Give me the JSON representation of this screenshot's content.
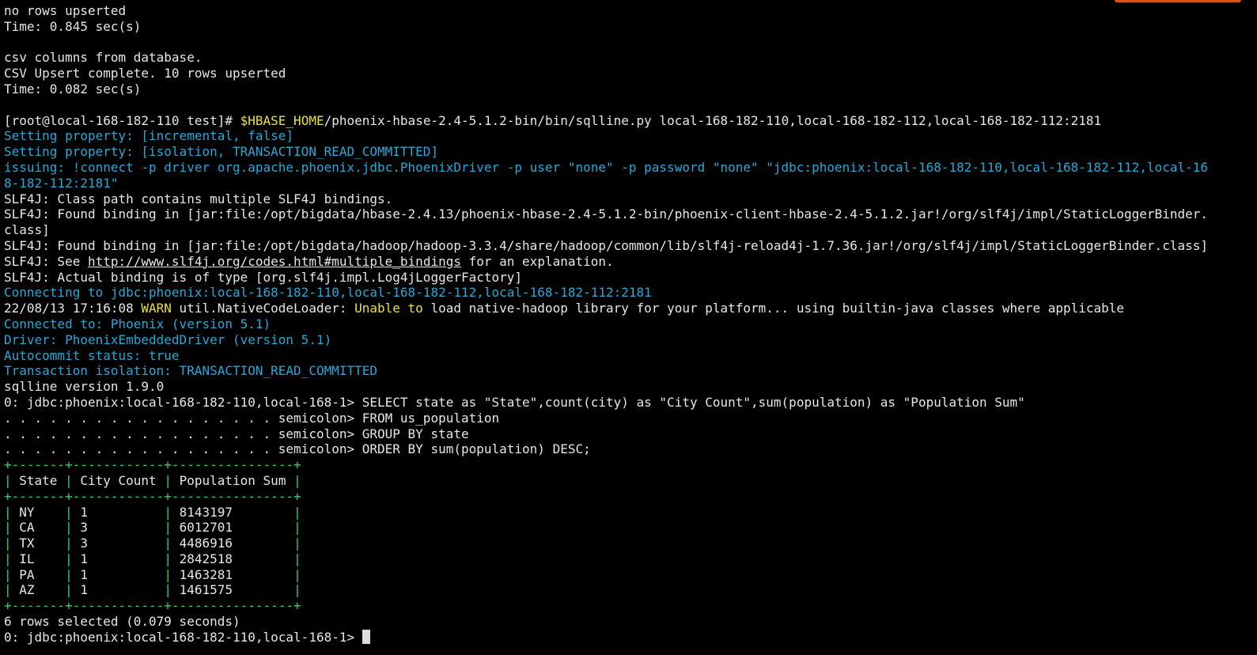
{
  "colors": {
    "background": "#000000",
    "text": "#e6e6e6",
    "info": "#26a8d8",
    "warn": "#e8e23a",
    "table_border": "#2fd17a",
    "accent": "#d9531e"
  },
  "terminal": {
    "pre_lines": [
      "no rows upserted",
      "Time: 0.845 sec(s)",
      "",
      "csv columns from database.",
      "CSV Upsert complete. 10 rows upserted",
      "Time: 0.082 sec(s)",
      ""
    ],
    "command": {
      "prompt": "[root@local-168-182-110 test]# ",
      "env_var": "$HBASE_HOME",
      "rest": "/phoenix-hbase-2.4-5.1.2-bin/bin/sqlline.py local-168-182-110,local-168-182-112,local-168-182-112:2181"
    },
    "setup_lines": [
      "Setting property: [incremental, false]",
      "Setting property: [isolation, TRANSACTION_READ_COMMITTED]",
      "issuing: !connect -p driver org.apache.phoenix.jdbc.PhoenixDriver -p user \"none\" -p password \"none\" \"jdbc:phoenix:local-168-182-110,local-168-182-112,local-16",
      "8-182-112:2181\""
    ],
    "slf4j_lines": [
      "SLF4J: Class path contains multiple SLF4J bindings.",
      "SLF4J: Found binding in [jar:file:/opt/bigdata/hbase-2.4.13/phoenix-hbase-2.4-5.1.2-bin/phoenix-client-hbase-2.4-5.1.2.jar!/org/slf4j/impl/StaticLoggerBinder.",
      "class]",
      "SLF4J: Found binding in [jar:file:/opt/bigdata/hadoop/hadoop-3.3.4/share/hadoop/common/lib/slf4j-reload4j-1.7.36.jar!/org/slf4j/impl/StaticLoggerBinder.class]"
    ],
    "slf4j_see": {
      "prefix": "SLF4J: See ",
      "link": "http://www.slf4j.org/codes.html#multiple_bindings",
      "suffix": " for an explanation."
    },
    "slf4j_actual": "SLF4J: Actual binding is of type [org.slf4j.impl.Log4jLoggerFactory]",
    "connecting": "Connecting to jdbc:phoenix:local-168-182-110,local-168-182-112,local-168-182-112:2181",
    "warn": {
      "timestamp": "22/08/13 17:16:08 ",
      "level": "WARN",
      "logger": " util.NativeCodeLoader: ",
      "highlight": "Unable to",
      "message": " load native-hadoop library for your platform... using builtin-java classes where applicable"
    },
    "connected_lines": [
      "Connected to: Phoenix (version 5.1)",
      "Driver: PhoenixEmbeddedDriver (version 5.1)",
      "Autocommit status: true",
      "Transaction isolation: TRANSACTION_READ_COMMITTED"
    ],
    "sqlline_version": "sqlline version 1.9.0",
    "query_lines": [
      "0: jdbc:phoenix:local-168-182-110,local-168-1> SELECT state as \"State\",count(city) as \"City Count\",sum(population) as \"Population Sum\"",
      ". . . . . . . . . . . . . . . . . . semicolon> FROM us_population",
      ". . . . . . . . . . . . . . . . . . semicolon> GROUP BY state",
      ". . . . . . . . . . . . . . . . . . semicolon> ORDER BY sum(population) DESC;"
    ],
    "table": {
      "border": "+-------+------------+----------------+",
      "header": [
        "State",
        "City Count",
        "Population Sum"
      ],
      "rows": [
        [
          "NY",
          "1",
          "8143197"
        ],
        [
          "CA",
          "3",
          "6012701"
        ],
        [
          "TX",
          "3",
          "4486916"
        ],
        [
          "IL",
          "1",
          "2842518"
        ],
        [
          "PA",
          "1",
          "1463281"
        ],
        [
          "AZ",
          "1",
          "1461575"
        ]
      ]
    },
    "result_summary": "6 rows selected (0.079 seconds)",
    "final_prompt": "0: jdbc:phoenix:local-168-182-110,local-168-1> "
  }
}
